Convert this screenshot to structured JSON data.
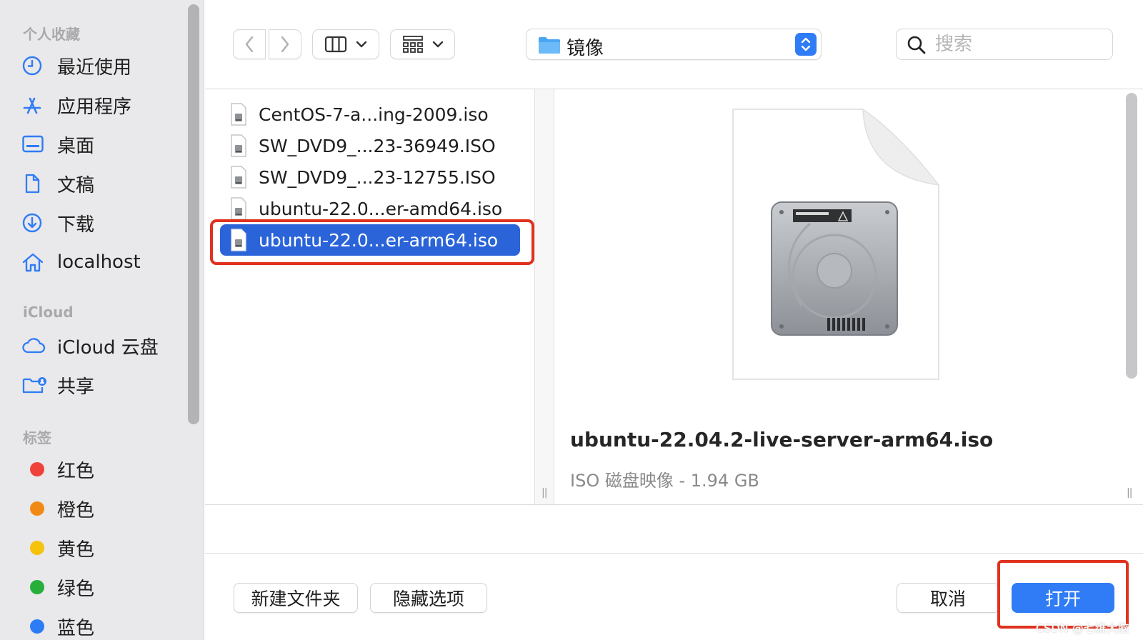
{
  "sidebar": {
    "favorites_title": "个人收藏",
    "favorites": [
      {
        "label": "最近使用",
        "icon": "clock-icon"
      },
      {
        "label": "应用程序",
        "icon": "apps-icon"
      },
      {
        "label": "桌面",
        "icon": "desktop-icon"
      },
      {
        "label": "文稿",
        "icon": "document-icon"
      },
      {
        "label": "下载",
        "icon": "download-icon"
      },
      {
        "label": "localhost",
        "icon": "home-icon"
      }
    ],
    "icloud_title": "iCloud",
    "icloud": [
      {
        "label": "iCloud 云盘",
        "icon": "cloud-icon"
      },
      {
        "label": "共享",
        "icon": "shared-folder-icon"
      }
    ],
    "tags_title": "标签",
    "tags": [
      {
        "label": "红色",
        "color": "#f0413b"
      },
      {
        "label": "橙色",
        "color": "#f18a14"
      },
      {
        "label": "黄色",
        "color": "#f5c20c"
      },
      {
        "label": "绿色",
        "color": "#27ae3b"
      },
      {
        "label": "蓝色",
        "color": "#2d7cf6"
      }
    ]
  },
  "toolbar": {
    "location": "镜像",
    "search_placeholder": "搜索"
  },
  "files": [
    {
      "name": "CentOS-7-a...ing-2009.iso",
      "selected": false
    },
    {
      "name": "SW_DVD9_...23-36949.ISO",
      "selected": false
    },
    {
      "name": "SW_DVD9_...23-12755.ISO",
      "selected": false
    },
    {
      "name": "ubuntu-22.0...er-amd64.iso",
      "selected": false
    },
    {
      "name": "ubuntu-22.0...er-arm64.iso",
      "selected": true
    }
  ],
  "preview": {
    "filename": "ubuntu-22.04.2-live-server-arm64.iso",
    "meta": "ISO 磁盘映像 - 1.94 GB"
  },
  "footer": {
    "new_folder": "新建文件夹",
    "hide_options": "隐藏选项",
    "cancel": "取消",
    "open": "打开"
  },
  "watermark": "CSDN @七维大脑",
  "colors": {
    "accent": "#2f7cf6",
    "selection": "#2a64d8",
    "highlight_outline": "#e0321f"
  }
}
